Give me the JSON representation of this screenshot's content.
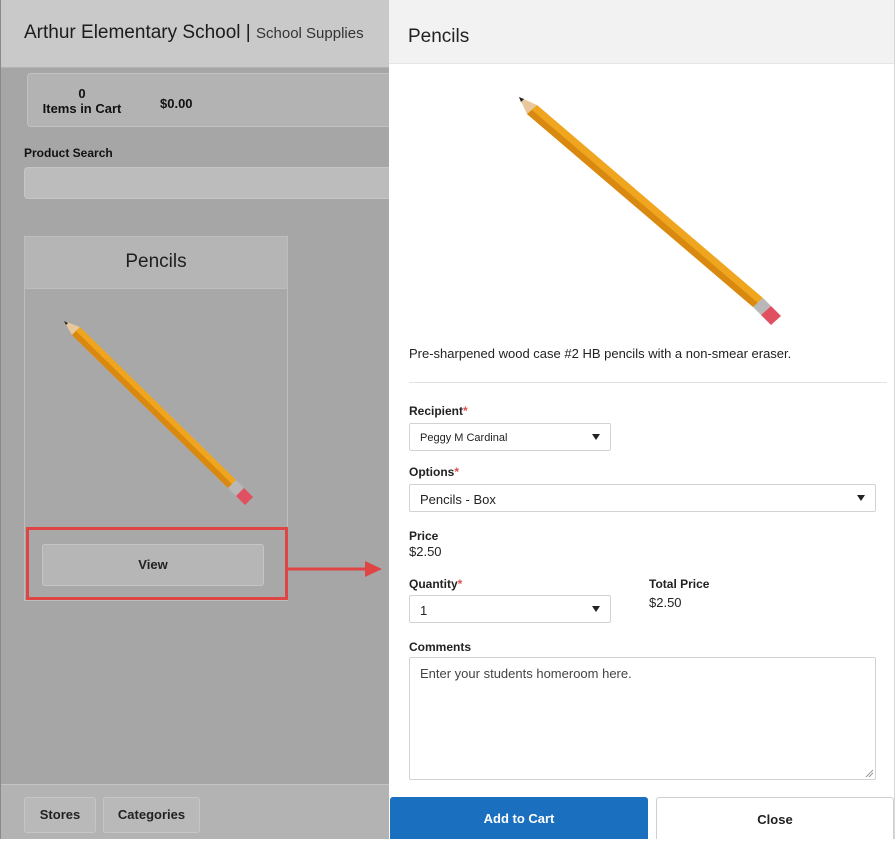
{
  "store": {
    "school_name": "Arthur Elementary School",
    "separator": "|",
    "store_name": "School Supplies"
  },
  "cart": {
    "count": "0",
    "count_label": "Items in Cart",
    "total": "$0.00"
  },
  "search": {
    "label": "Product Search",
    "placeholder": ""
  },
  "product_card": {
    "title": "Pencils",
    "view_label": "View"
  },
  "bottom_nav": {
    "stores_label": "Stores",
    "categories_label": "Categories"
  },
  "detail": {
    "title": "Pencils",
    "description": "Pre-sharpened wood case #2 HB pencils with a non-smear eraser.",
    "recipient_label": "Recipient",
    "recipient_value": "Peggy M Cardinal",
    "options_label": "Options",
    "options_value": "Pencils - Box",
    "price_label": "Price",
    "price_value": "$2.50",
    "quantity_label": "Quantity",
    "quantity_value": "1",
    "total_price_label": "Total Price",
    "total_price_value": "$2.50",
    "comments_label": "Comments",
    "comments_value": "Enter your students homeroom here.",
    "required_marker": "*",
    "add_to_cart_label": "Add to Cart",
    "close_label": "Close"
  },
  "colors": {
    "primary_button": "#1a6fbf",
    "highlight": "#e04545",
    "overlay": "#a6a6a6",
    "required": "#d9534f"
  },
  "icons": {
    "product_image": "pencil-icon",
    "dropdown": "chevron-down-icon",
    "annotation": "arrow-right-icon"
  }
}
